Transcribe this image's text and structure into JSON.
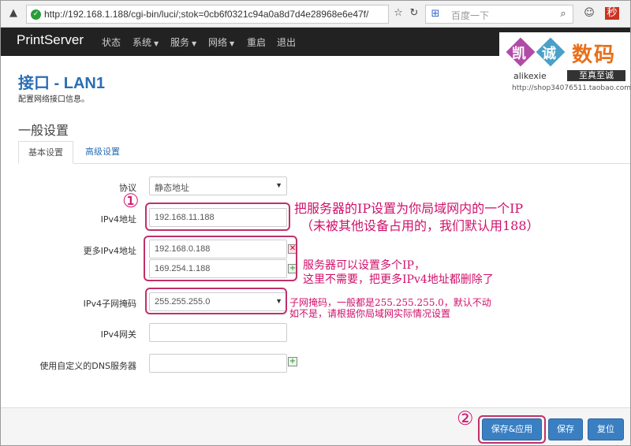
{
  "browser": {
    "url": "http://192.168.1.188/cgi-bin/luci/;stok=0cb6f0321c94a0a8d7d4e28968e6e47f/",
    "search_placeholder": "百度一下"
  },
  "navbar": {
    "brand": "PrintServer",
    "items": [
      "状态",
      "系统",
      "服务",
      "网络",
      "重启",
      "退出"
    ]
  },
  "watermark": {
    "cn1": "凯",
    "cn2": "诚",
    "num": "数码",
    "sub": "alikexie",
    "badge": "至真至诚",
    "url": "http://shop34076511.taobao.com"
  },
  "page": {
    "title": "接口 - LAN1",
    "description": "配置网络接口信息。",
    "section": "一般设置",
    "tabs": [
      "基本设置",
      "高级设置"
    ]
  },
  "form": {
    "protocol_label": "协议",
    "protocol_value": "静态地址",
    "ipv4_label": "IPv4地址",
    "ipv4_value": "192.168.11.188",
    "more_ipv4_label": "更多IPv4地址",
    "more_ipv4_values": [
      "192.168.0.188",
      "169.254.1.188"
    ],
    "netmask_label": "IPv4子网掩码",
    "netmask_value": "255.255.255.0",
    "gateway_label": "IPv4网关",
    "gateway_value": "",
    "dns_label": "使用自定义的DNS服务器",
    "dns_value": ""
  },
  "annotations": {
    "circle1": "①",
    "circle2": "②",
    "note1_line1": "把服务器的IP设置为你局域网内的一个IP",
    "note1_line2": "（未被其他设备占用的，我们默认用188）",
    "note2_line1": "服务器可以设置多个IP，",
    "note2_line2": "这里不需要，把更多IPv4地址都删除了",
    "note3_line1": "子网掩码，一般都是255.255.255.0，默认不动",
    "note3_line2": "如不是，请根据你局域网实际情况设置"
  },
  "actions": {
    "save_apply": "保存&应用",
    "save": "保存",
    "reset": "复位"
  },
  "colors": {
    "navbar_bg": "#222222",
    "accent": "#2a6eb4",
    "button": "#3a7fc2",
    "annotation": "#d0106a"
  }
}
